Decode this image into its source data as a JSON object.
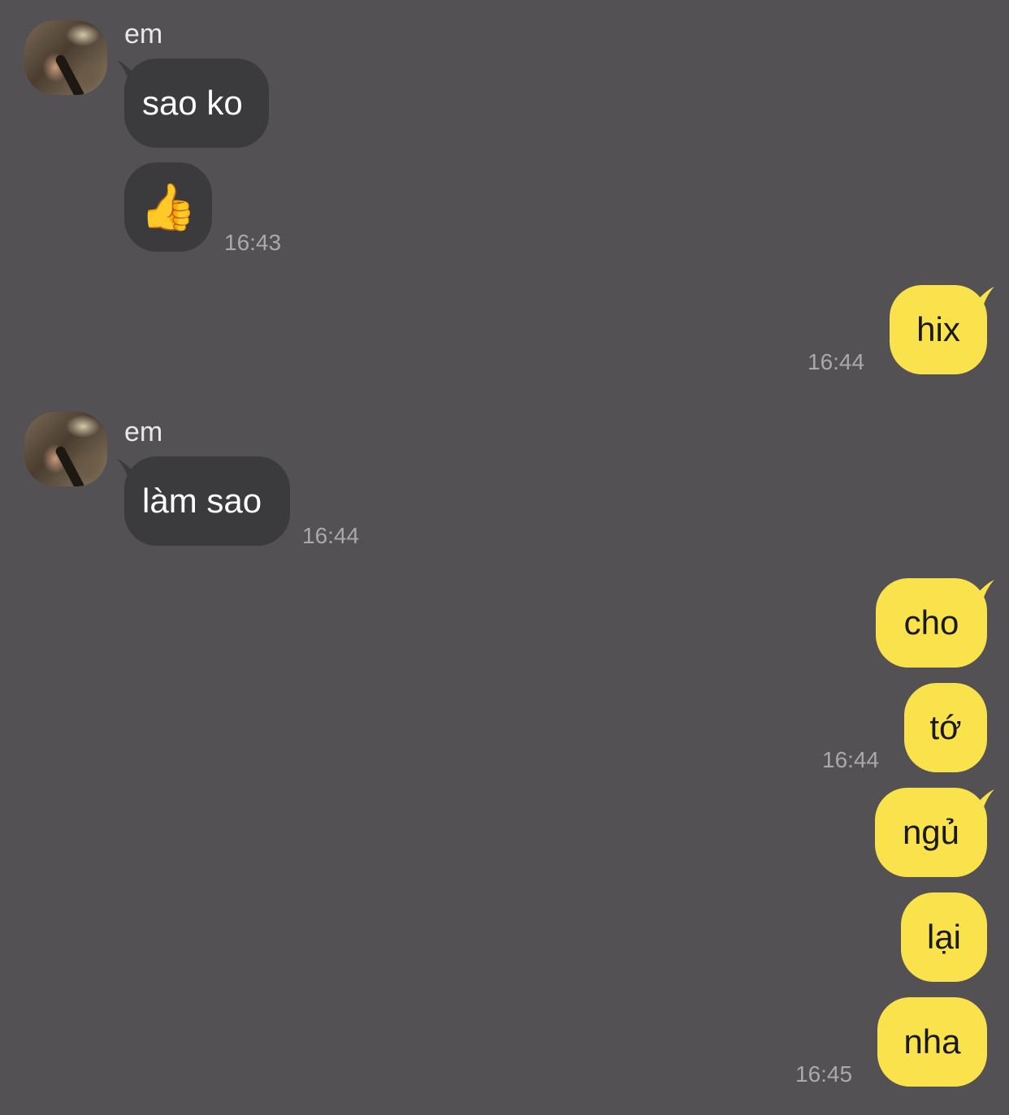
{
  "messages": [
    {
      "sender": "em",
      "text": "sao ko"
    },
    {
      "sender": "em",
      "text": "👍",
      "time": "16:43"
    },
    {
      "sender": "me",
      "text": "hix",
      "time": "16:44"
    },
    {
      "sender": "em",
      "text": "làm sao",
      "time": "16:44"
    },
    {
      "sender": "me",
      "text": "cho"
    },
    {
      "sender": "me",
      "text": "tớ",
      "time": "16:44"
    },
    {
      "sender": "me",
      "text": "ngủ"
    },
    {
      "sender": "me",
      "text": "lại"
    },
    {
      "sender": "me",
      "text": "nha",
      "time": "16:45"
    }
  ],
  "colors": {
    "background": "#535153",
    "incoming_bubble": "#3b3a3c",
    "outgoing_bubble": "#f9e24b"
  }
}
